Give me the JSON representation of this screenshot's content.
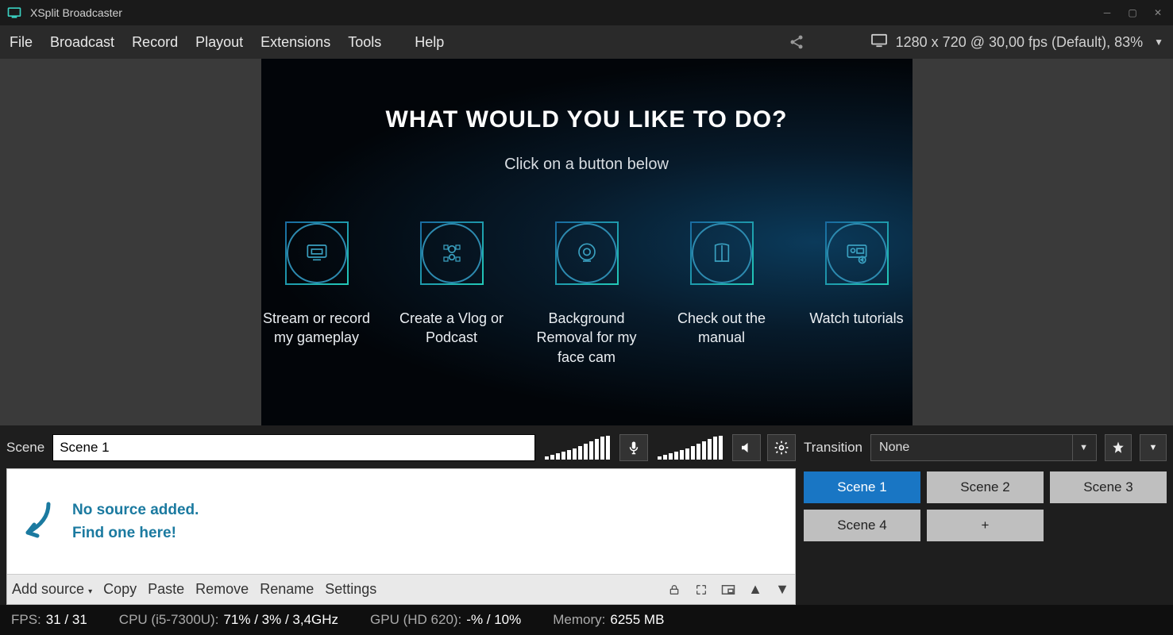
{
  "app": {
    "title": "XSplit Broadcaster"
  },
  "menu": {
    "file": "File",
    "broadcast": "Broadcast",
    "record": "Record",
    "playout": "Playout",
    "extensions": "Extensions",
    "tools": "Tools",
    "help": "Help",
    "resolution_status": "1280 x 720 @ 30,00 fps (Default), 83%"
  },
  "onboard": {
    "heading": "WHAT WOULD YOU LIKE TO DO?",
    "sub": "Click on a button below",
    "options": [
      "Stream or record my gameplay",
      "Create a Vlog or Podcast",
      "Background Removal for my face cam",
      "Check out the manual",
      "Watch tutorials"
    ]
  },
  "scene": {
    "label": "Scene",
    "name": "Scene 1",
    "no_source_line1": "No source added.",
    "no_source_line2": "Find one here!",
    "toolbar": {
      "add": "Add source",
      "copy": "Copy",
      "paste": "Paste",
      "remove": "Remove",
      "rename": "Rename",
      "settings": "Settings"
    }
  },
  "transition": {
    "label": "Transition",
    "value": "None"
  },
  "scenes": {
    "s1": "Scene 1",
    "s2": "Scene 2",
    "s3": "Scene 3",
    "s4": "Scene 4",
    "add": "+"
  },
  "status": {
    "fps_label": "FPS:",
    "fps_value": "31 / 31",
    "cpu_label": "CPU (i5-7300U):",
    "cpu_value": "71% / 3% / 3,4GHz",
    "gpu_label": "GPU (HD 620):",
    "gpu_value": "-% / 10%",
    "mem_label": "Memory:",
    "mem_value": "6255 MB"
  }
}
